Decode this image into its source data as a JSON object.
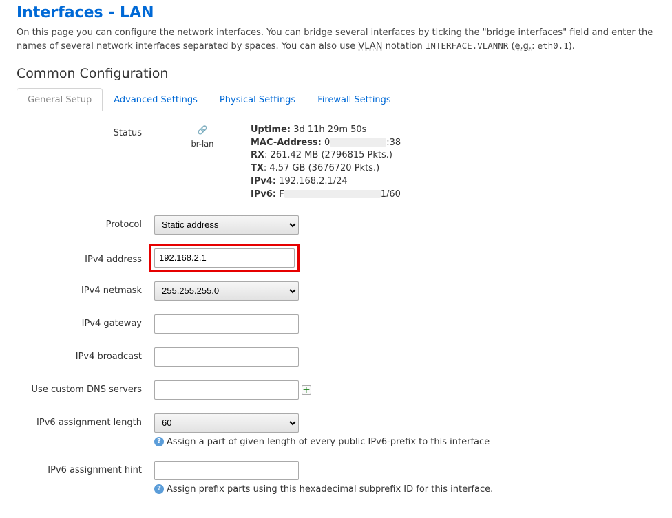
{
  "title": "Interfaces - LAN",
  "desc_parts": {
    "p1": "On this page you can configure the network interfaces. You can bridge several interfaces by ticking the \"bridge interfaces\" field and enter the names of several network interfaces separated by spaces. You can also use ",
    "vlan": "VLAN",
    "p2": " notation ",
    "code1": "INTERFACE.VLANNR",
    "p3": " (",
    "eg": "e.g.",
    "p4": ": ",
    "code2": "eth0.1",
    "p5": ")."
  },
  "section": "Common Configuration",
  "tabs": [
    {
      "key": "general",
      "label": "General Setup",
      "active": true
    },
    {
      "key": "advanced",
      "label": "Advanced Settings",
      "active": false
    },
    {
      "key": "physical",
      "label": "Physical Settings",
      "active": false
    },
    {
      "key": "firewall",
      "label": "Firewall Settings",
      "active": false
    }
  ],
  "labels": {
    "status": "Status",
    "protocol": "Protocol",
    "ipv4_addr": "IPv4 address",
    "ipv4_mask": "IPv4 netmask",
    "ipv4_gw": "IPv4 gateway",
    "ipv4_bcast": "IPv4 broadcast",
    "dns": "Use custom DNS servers",
    "ipv6_len": "IPv6 assignment length",
    "ipv6_hint": "IPv6 assignment hint"
  },
  "status": {
    "ifname": "br-lan",
    "uptime_label": "Uptime:",
    "uptime": "3d 11h 29m 50s",
    "mac_label": "MAC-Address:",
    "mac_prefix": "0",
    "mac_suffix": ":38",
    "rx_label": "RX",
    "rx": ": 261.42 MB (2796815 Pkts.)",
    "tx_label": "TX",
    "tx": ": 4.57 GB (3676720 Pkts.)",
    "ipv4_label": "IPv4:",
    "ipv4": "192.168.2.1/24",
    "ipv6_label": "IPv6:",
    "ipv6_prefix": "F",
    "ipv6_suffix": "1/60"
  },
  "fields": {
    "protocol": "Static address",
    "ipv4_addr": "192.168.2.1",
    "ipv4_mask": "255.255.255.0",
    "ipv4_gw": "",
    "ipv4_bcast": "",
    "dns": "",
    "ipv6_len": "60",
    "ipv6_hint": ""
  },
  "hints": {
    "ipv6_len": "Assign a part of given length of every public IPv6-prefix to this interface",
    "ipv6_hint": "Assign prefix parts using this hexadecimal subprefix ID for this interface."
  }
}
